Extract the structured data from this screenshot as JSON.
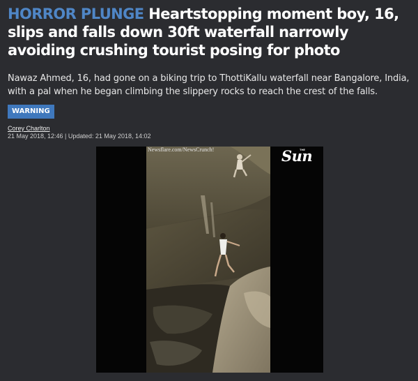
{
  "article": {
    "kicker": "HORROR PLUNGE",
    "headline": "Heartstopping moment boy, 16, slips and falls down 30ft waterfall narrowly avoiding crushing tourist posing for photo",
    "standfirst": "Nawaz Ahmed, 16, had gone on a biking trip to ThottiKallu waterfall near Bangalore, India, with a pal when he began climbing the slippery rocks to reach the crest of the falls.",
    "badge": "WARNING",
    "author": "Corey Charlton",
    "dates": "21 May 2018, 12:46 | Updated: 21 May 2018, 14:02"
  },
  "video": {
    "watermark": "Newsflare.com/NewsCrunch!",
    "logo_main": "Sun",
    "logo_small": "THE"
  },
  "colors": {
    "background": "#2b2c30",
    "kicker": "#4f86c6",
    "badge": "#3f78bd"
  }
}
